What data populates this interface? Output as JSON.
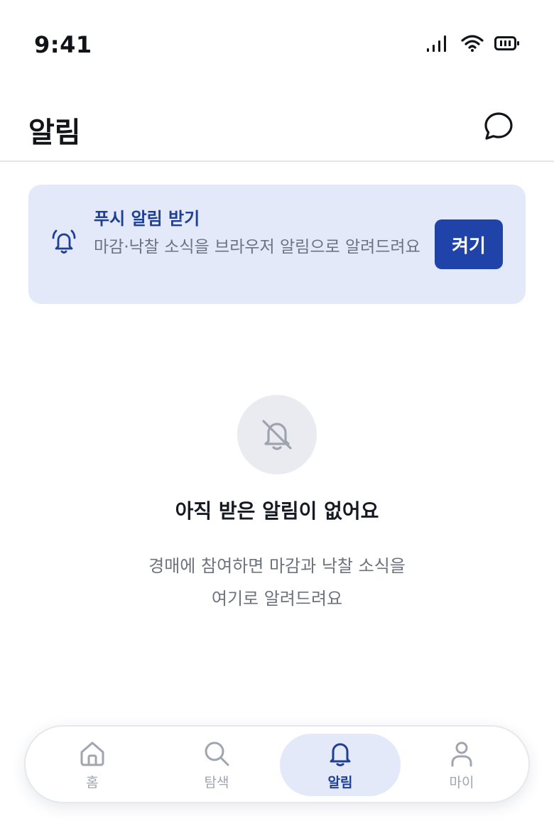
{
  "status_bar": {
    "time": "9:41"
  },
  "header": {
    "title": "알림"
  },
  "push_banner": {
    "title": "푸시 알림 받기",
    "description": "마감·낙찰 소식을 브라우저 알림으로 알려드려요",
    "button_label": "켜기"
  },
  "empty_state": {
    "title": "아직 받은 알림이 없어요",
    "description_line1": "경매에 참여하면 마감과 낙찰 소식을",
    "description_line2": "여기로 알려드려요"
  },
  "tab_bar": {
    "items": [
      {
        "label": "홈",
        "icon": "home-icon",
        "active": false
      },
      {
        "label": "탐색",
        "icon": "search-icon",
        "active": false
      },
      {
        "label": "알림",
        "icon": "bell-icon",
        "active": true
      },
      {
        "label": "마이",
        "icon": "person-icon",
        "active": false
      }
    ]
  },
  "colors": {
    "accent": "#1f43a8",
    "banner_bg": "#e3e9f9",
    "muted_text": "#6d727e",
    "inactive_tab": "#a0a5b0"
  }
}
